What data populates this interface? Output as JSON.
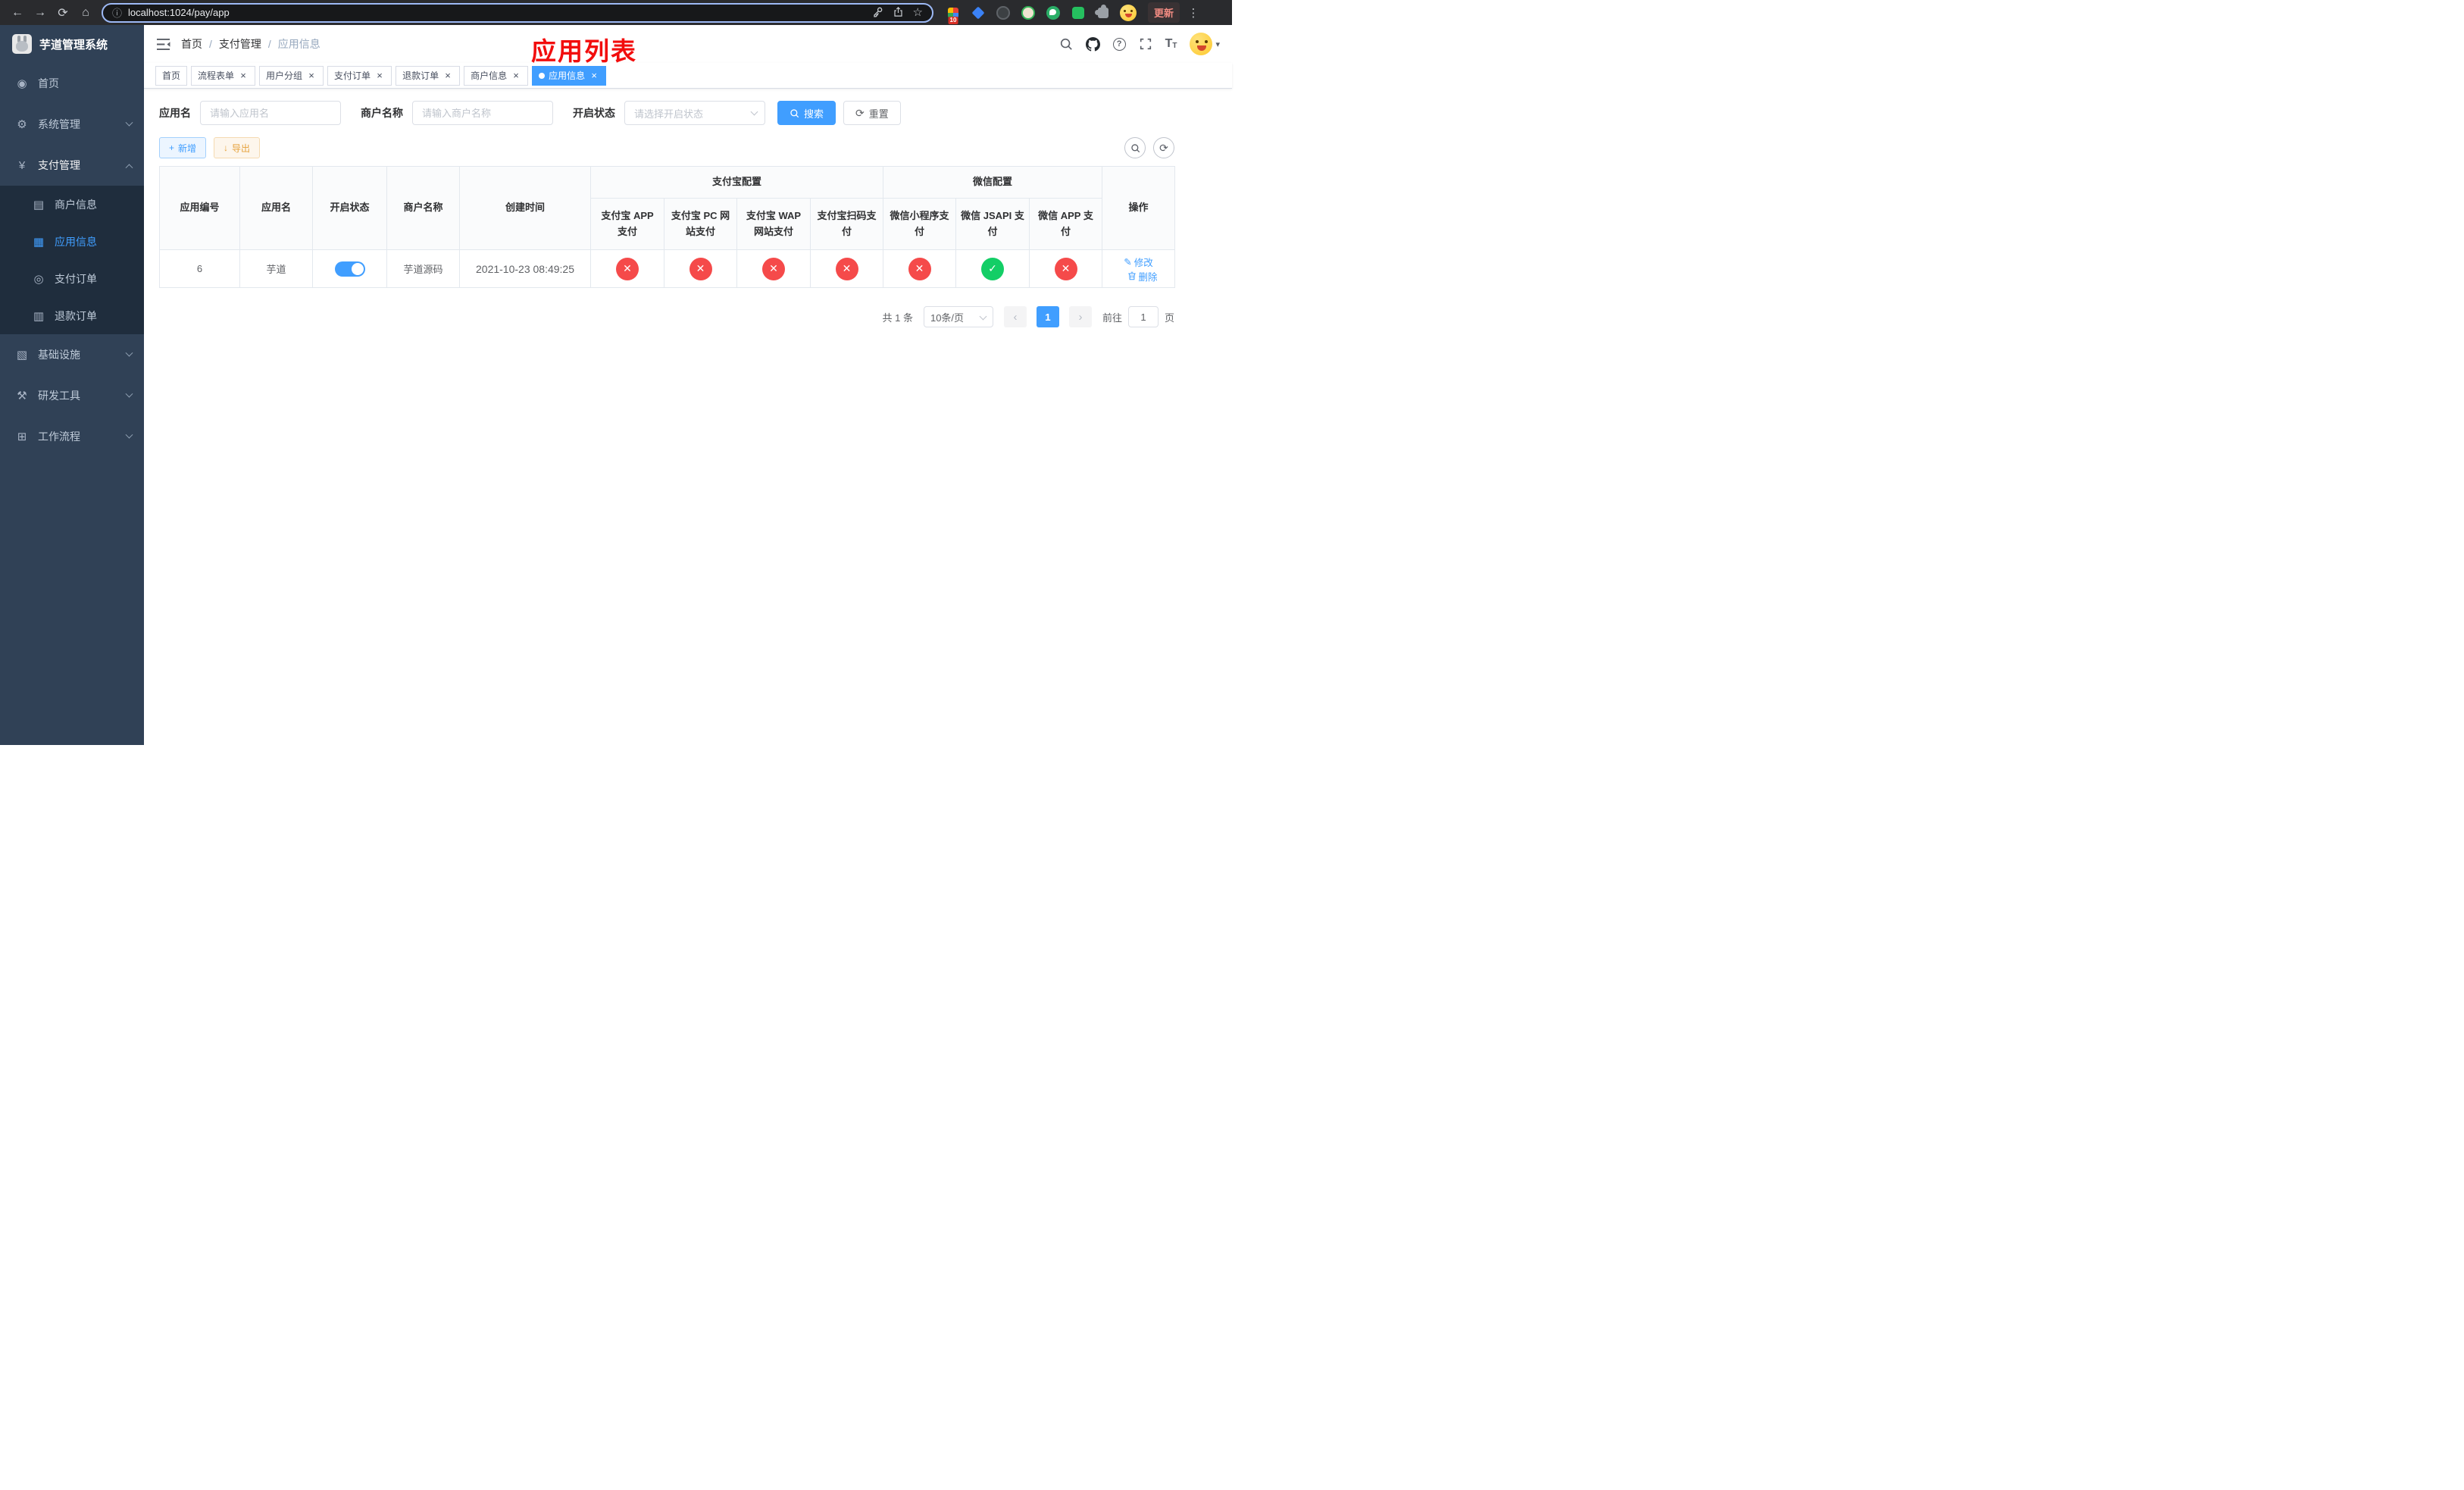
{
  "colors": {
    "primary": "#409eff",
    "success": "#13ce66",
    "danger": "#f54a4a",
    "warning": "#e6a23c",
    "title_red": "#f20d0d",
    "sidebar_bg": "#304156",
    "sidebar_submenu_bg": "#1f2d3d",
    "sidebar_text": "#bfcbd9"
  },
  "icons": {
    "back": "←",
    "forward": "→",
    "reload": "⟳",
    "home": "⌂",
    "info": "ⓘ",
    "star": "☆",
    "kebab": "⋮",
    "dashboard": "◉",
    "gear": "⚙",
    "yen": "¥",
    "merchant": "▤",
    "app": "▦",
    "pay_order": "◎",
    "refund_order": "▥",
    "infrastructure": "▧",
    "dev_tools": "⚒",
    "workflow": "⊞",
    "close": "×",
    "plus": "+",
    "download": "↓",
    "refresh": "⟳",
    "edit": "✎",
    "help": "?",
    "font": "T",
    "caret_down": "▾",
    "prev": "‹",
    "next": "›",
    "check": "✓",
    "cross": "✕"
  },
  "browser": {
    "url": "localhost:1024/pay/app",
    "update_label": "更新",
    "extension_badge": "10"
  },
  "sidebar": {
    "title": "芋道管理系统",
    "items": [
      {
        "label": "首页",
        "icon": "dashboard-icon"
      },
      {
        "label": "系统管理",
        "icon": "gear-icon",
        "expandable": true
      },
      {
        "label": "支付管理",
        "icon": "yen-icon",
        "expandable": true,
        "expanded": true
      },
      {
        "label": "商户信息",
        "icon": "merchant-card-icon"
      },
      {
        "label": "应用信息",
        "icon": "app-grid-icon",
        "active": true
      },
      {
        "label": "支付订单",
        "icon": "pay-order-icon"
      },
      {
        "label": "退款订单",
        "icon": "refund-order-icon"
      },
      {
        "label": "基础设施",
        "icon": "infrastructure-icon",
        "expandable": true
      },
      {
        "label": "研发工具",
        "icon": "dev-tools-icon",
        "expandable": true
      },
      {
        "label": "工作流程",
        "icon": "workflow-icon",
        "expandable": true
      }
    ]
  },
  "header": {
    "breadcrumb": [
      "首页",
      "支付管理",
      "应用信息"
    ],
    "breadcrumb_separator": "/",
    "page_title": "应用列表"
  },
  "tabs": [
    {
      "label": "首页",
      "closable": false,
      "active": false
    },
    {
      "label": "流程表单",
      "closable": true,
      "active": false
    },
    {
      "label": "用户分组",
      "closable": true,
      "active": false
    },
    {
      "label": "支付订单",
      "closable": true,
      "active": false
    },
    {
      "label": "退款订单",
      "closable": true,
      "active": false
    },
    {
      "label": "商户信息",
      "closable": true,
      "active": false
    },
    {
      "label": "应用信息",
      "closable": true,
      "active": true
    }
  ],
  "filters": {
    "app_name_label": "应用名",
    "app_name_placeholder": "请输入应用名",
    "merchant_label": "商户名称",
    "merchant_placeholder": "请输入商户名称",
    "status_label": "开启状态",
    "status_placeholder": "请选择开启状态",
    "search_label": "搜索",
    "reset_label": "重置"
  },
  "toolbar": {
    "add_label": "新增",
    "export_label": "导出"
  },
  "table": {
    "main_columns": [
      "应用编号",
      "应用名",
      "开启状态",
      "商户名称",
      "创建时间"
    ],
    "alipay_group": "支付宝配置",
    "alipay_columns": [
      "支付宝 APP 支付",
      "支付宝 PC 网站支付",
      "支付宝 WAP 网站支付",
      "支付宝扫码支付"
    ],
    "wechat_group": "微信配置",
    "wechat_columns": [
      "微信小程序支付",
      "微信 JSAPI 支付",
      "微信 APP 支付"
    ],
    "actions_column": "操作",
    "row": {
      "id": "6",
      "name": "芋道",
      "enabled": true,
      "merchant": "芋道源码",
      "created_at": "2021-10-23 08:49:25",
      "pay_statuses": [
        false,
        false,
        false,
        false,
        false,
        true,
        false
      ],
      "edit_label": "修改",
      "delete_label": "删除"
    }
  },
  "pagination": {
    "total": "共 1 条",
    "page_size": "10条/页",
    "page": "1",
    "goto_prefix": "前往",
    "goto_value": "1",
    "goto_suffix": "页"
  }
}
